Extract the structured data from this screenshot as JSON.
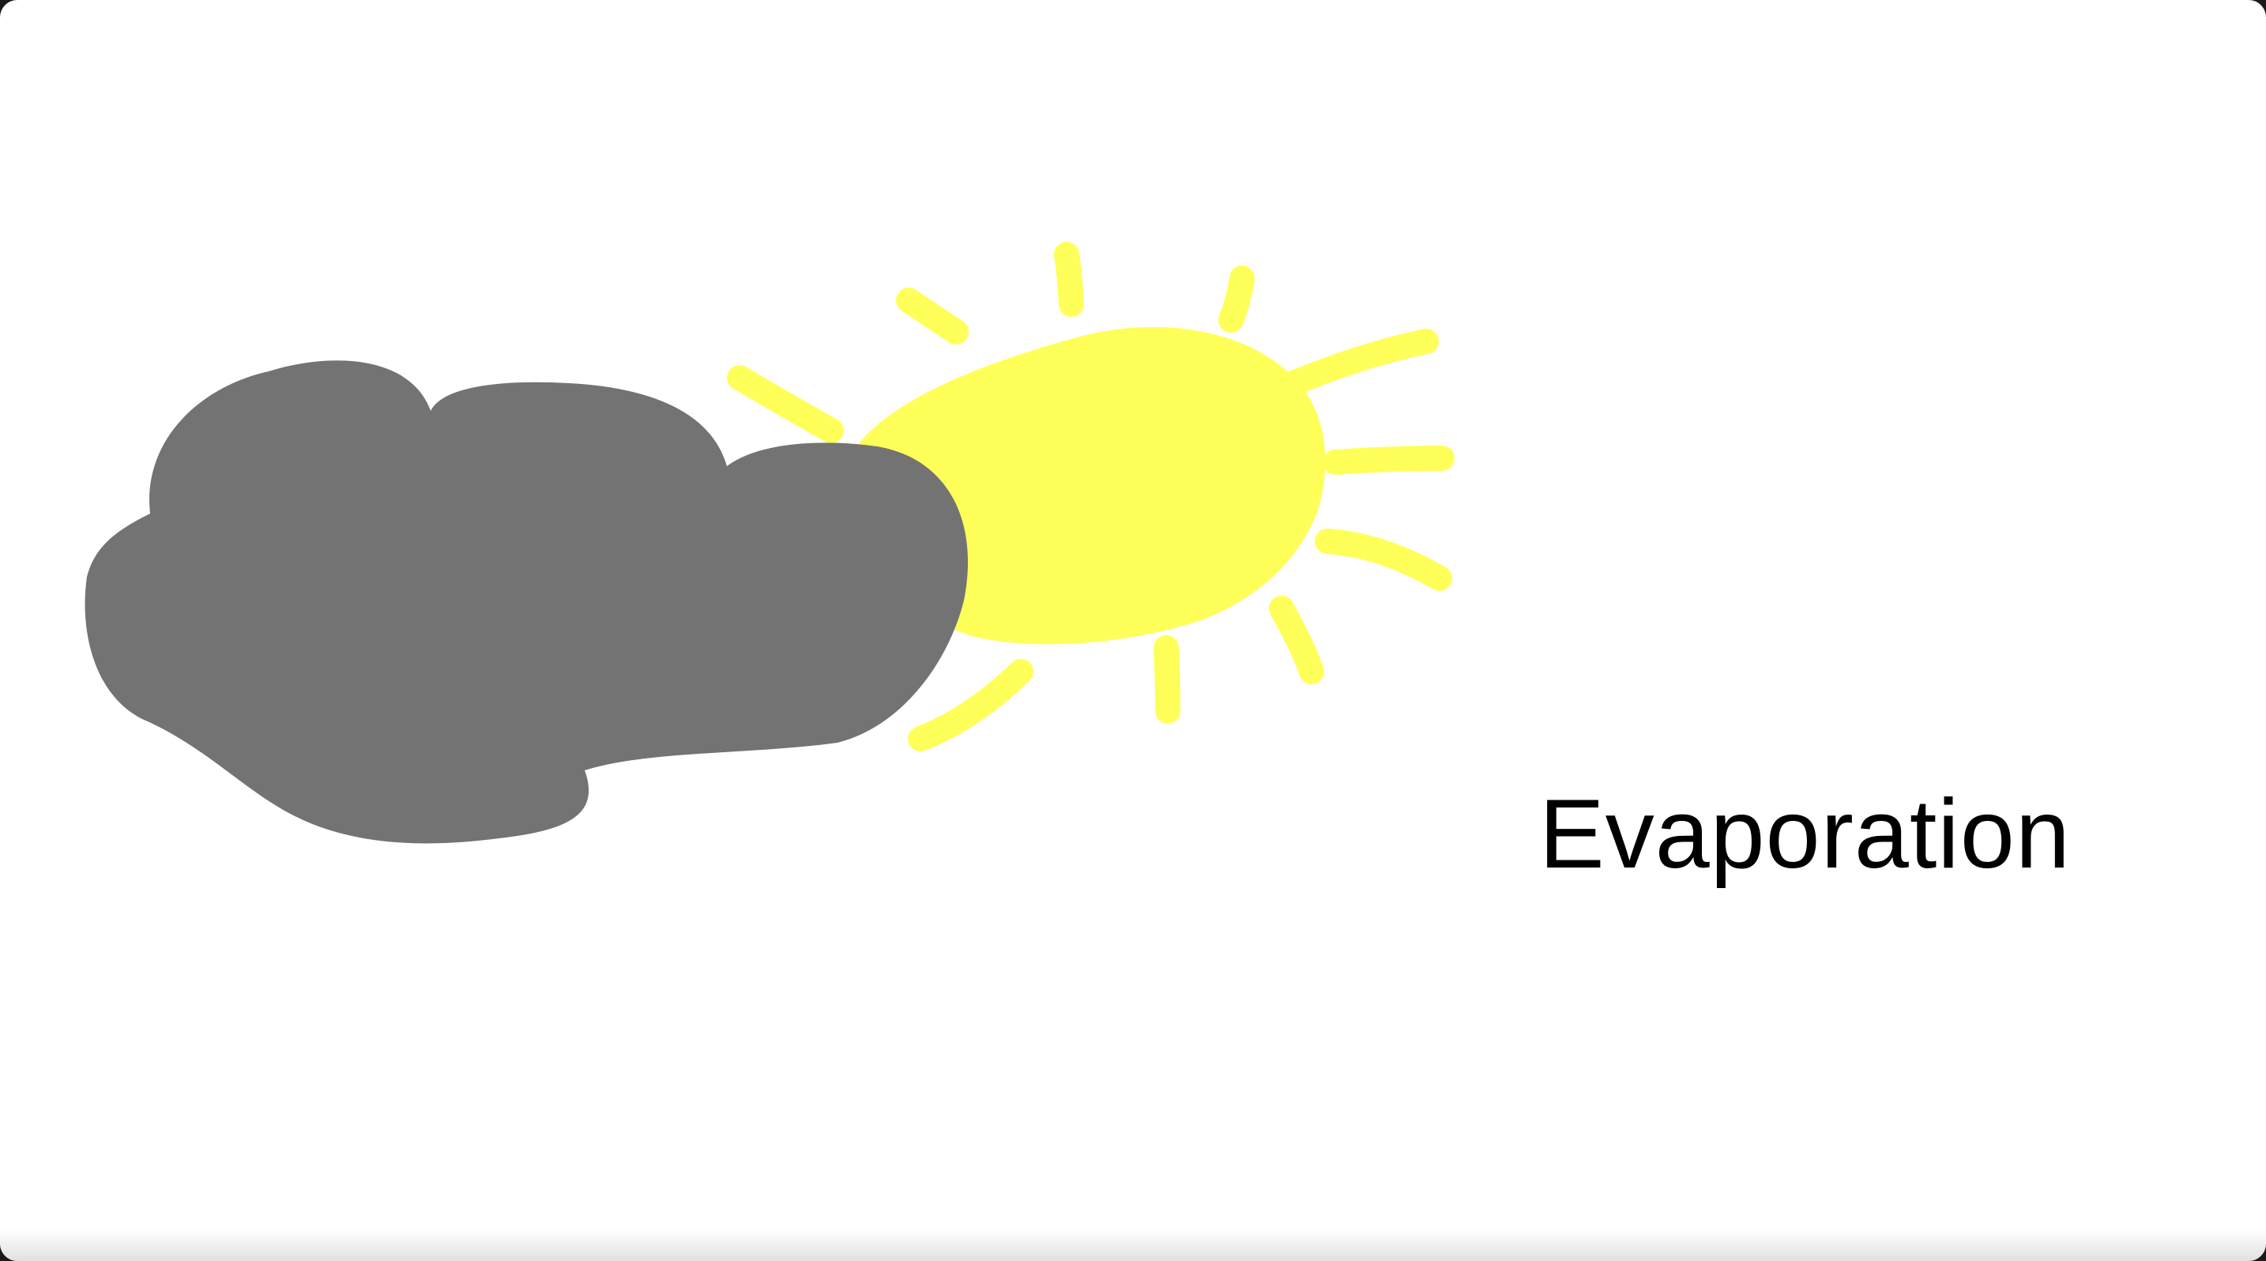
{
  "slide": {
    "caption": "Evaporation",
    "background_color": "#ffffff"
  },
  "illustration": {
    "cloud": {
      "icon": "cloud-icon",
      "color": "#737373"
    },
    "sun": {
      "icon": "sun-icon",
      "color": "#ffff5a"
    }
  }
}
